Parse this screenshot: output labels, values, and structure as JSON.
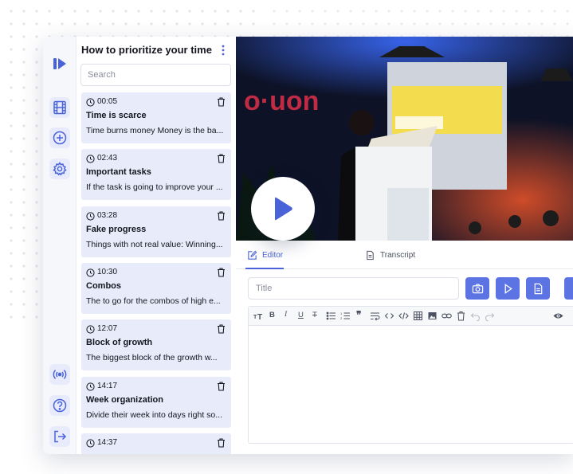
{
  "colors": {
    "accent": "#4a63d9",
    "button": "#5b73e3",
    "item_bg": "#e8ebf9"
  },
  "sidebar": {
    "icons": [
      "logo-icon",
      "film-icon",
      "add-icon",
      "settings-icon",
      "broadcast-icon",
      "help-icon",
      "logout-icon"
    ]
  },
  "list": {
    "title": "How to prioritize your time",
    "search_placeholder": "Search",
    "items": [
      {
        "time": "00:05",
        "title": "Time is scarce",
        "desc": "Time burns money Money is the ba..."
      },
      {
        "time": "02:43",
        "title": "Important tasks",
        "desc": "If the task is going to improve your ..."
      },
      {
        "time": "03:28",
        "title": "Fake progress",
        "desc": "Things with not real value: Winning..."
      },
      {
        "time": "10:30",
        "title": "Combos",
        "desc": "The to go for the combos of high e..."
      },
      {
        "time": "12:07",
        "title": "Block of growth",
        "desc": "The biggest block of the growth w..."
      },
      {
        "time": "14:17",
        "title": "Week organization",
        "desc": "Divide their week into days right so..."
      },
      {
        "time": "14:37",
        "title": "",
        "desc": ""
      }
    ]
  },
  "tabs": {
    "editor": "Editor",
    "transcript": "Transcript"
  },
  "editor": {
    "title_placeholder": "Title",
    "toolbar": [
      "text-size",
      "bold",
      "italic",
      "underline",
      "strikethrough",
      "bullet-list",
      "numbered-list",
      "quote",
      "wrap",
      "code",
      "code-block",
      "table",
      "image",
      "link",
      "delete",
      "undo",
      "redo",
      "preview"
    ]
  }
}
